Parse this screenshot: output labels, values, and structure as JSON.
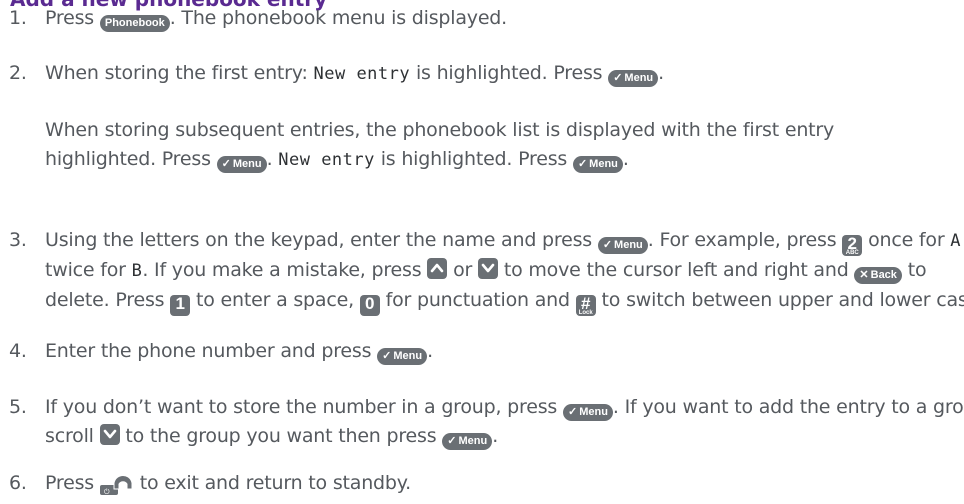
{
  "heading": "Add a new phonebook entry",
  "icons": {
    "phonebook_button": "phonebook-button-icon",
    "menu_button": "menu-ok-button-icon",
    "back_button": "back-delete-button-icon",
    "up_button": "up-arrow-button-icon",
    "down_button": "down-arrow-button-icon",
    "key_2": "key-2-abc-icon",
    "key_1": "key-1-icon",
    "key_0": "key-0-icon",
    "key_hash": "key-hash-lock-icon",
    "end_call": "end-call-handset-icon"
  },
  "buttons": {
    "phonebook": "Phonebook",
    "menu": "Menu",
    "back": "Back",
    "key_2": "2",
    "key_2_sub": "ABC",
    "key_1": "1",
    "key_0": "0",
    "key_hash": "#",
    "key_hash_sub": "Lock"
  },
  "steps": {
    "s1": {
      "num": "1.",
      "a": "Press ",
      "b": ". The phonebook menu is displayed."
    },
    "s2": {
      "num": "2.",
      "a": "When storing the first entry: ",
      "lcd": "New entry",
      "b": " is highlighted. Press ",
      "c": "."
    },
    "s2b": {
      "a": "When storing subsequent entries, the phonebook list is displayed with the first entry highlighted. Press ",
      "b": ". ",
      "lcd": "New entry",
      "c": " is highlighted. Press ",
      "d": "."
    },
    "s3": {
      "num": "3.",
      "a": "Using the letters on the keypad, enter the name and press ",
      "b": ". For example, press ",
      "c": " once for ",
      "lcd1": "A",
      "d": " ,or twice for ",
      "lcd2": "B",
      "e": ". If you make a mistake, press ",
      "f": " or ",
      "g": " to move the cursor left and right and ",
      "h": " to delete. Press ",
      "i": " to enter a space, ",
      "j": " for punctuation and ",
      "k": " to switch between upper and lower case."
    },
    "s4": {
      "num": "4.",
      "a": "Enter the phone number and press ",
      "b": "."
    },
    "s5": {
      "num": "5.",
      "a": "If you don’t want to store the number in a group, press ",
      "b": ". If you want to add the entry to a group, scroll ",
      "c": " to the group you want then press ",
      "d": "."
    },
    "s6": {
      "num": "6.",
      "a": "Press ",
      "b": " to exit and return to standby."
    }
  }
}
